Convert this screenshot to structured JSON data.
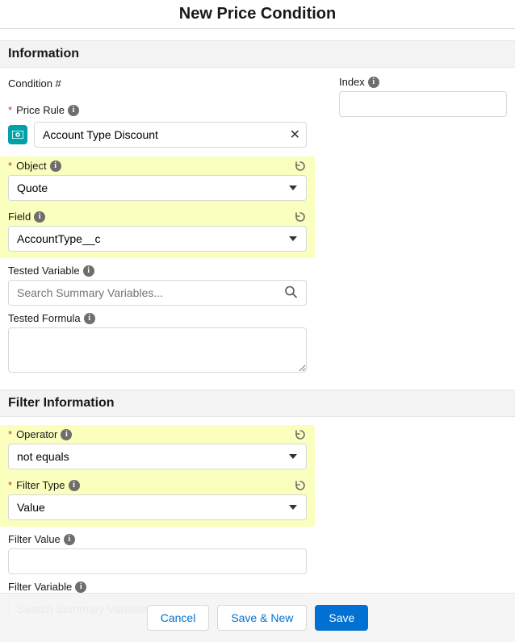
{
  "title": "New Price Condition",
  "sections": {
    "info": "Information",
    "filter": "Filter Information"
  },
  "labels": {
    "condition_num": "Condition #",
    "index": "Index",
    "price_rule": "Price Rule",
    "object": "Object",
    "field": "Field",
    "tested_variable": "Tested Variable",
    "tested_formula": "Tested Formula",
    "operator": "Operator",
    "filter_type": "Filter Type",
    "filter_value": "Filter Value",
    "filter_variable": "Filter Variable"
  },
  "values": {
    "price_rule": "Account Type Discount",
    "object": "Quote",
    "field": "AccountType__c",
    "operator": "not equals",
    "filter_type": "Value",
    "filter_value": "",
    "tested_formula": "",
    "index": ""
  },
  "placeholders": {
    "search_summary_variables": "Search Summary Variables..."
  },
  "buttons": {
    "cancel": "Cancel",
    "save_new": "Save & New",
    "save": "Save"
  }
}
